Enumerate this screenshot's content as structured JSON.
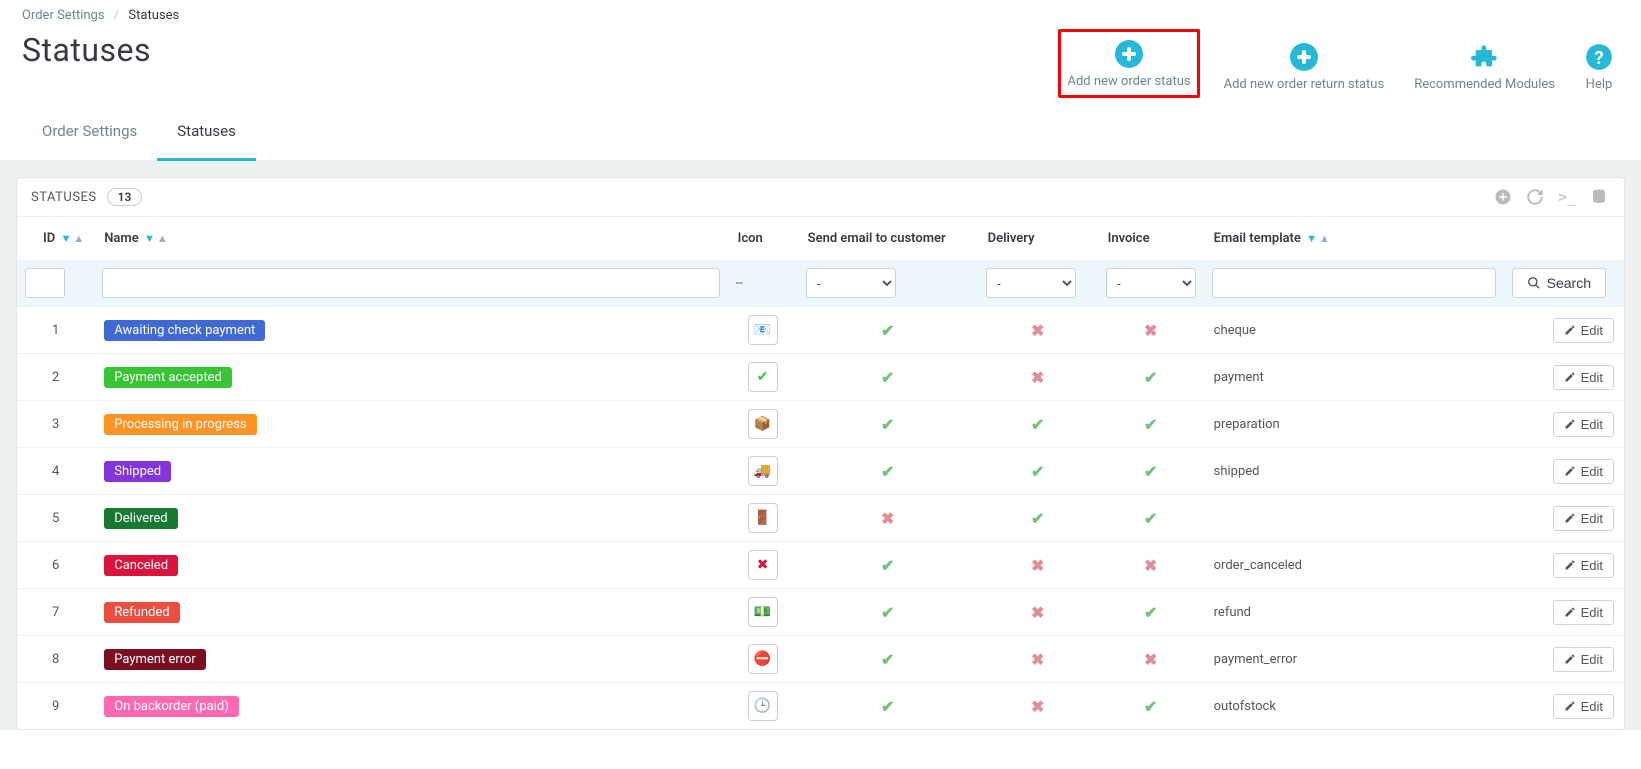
{
  "breadcrumb": {
    "parent": "Order Settings",
    "current": "Statuses"
  },
  "pageTitle": "Statuses",
  "toolbar": {
    "addOrder": "Add new order status",
    "addReturn": "Add new order return status",
    "modules": "Recommended Modules",
    "help": "Help"
  },
  "tabs": {
    "orderSettings": "Order Settings",
    "statuses": "Statuses"
  },
  "panel": {
    "title": "STATUSES",
    "count": "13",
    "searchBtn": "Search",
    "editLabel": "Edit"
  },
  "columns": {
    "id": "ID",
    "name": "Name",
    "icon": "Icon",
    "email": "Send email to customer",
    "delivery": "Delivery",
    "invoice": "Invoice",
    "template": "Email template"
  },
  "filterDash": "--",
  "filterOption": "-",
  "rows": [
    {
      "id": "1",
      "name": "Awaiting check payment",
      "color": "#4069d3",
      "email": true,
      "delivery": false,
      "invoice": false,
      "template": "cheque",
      "icon": "envelope"
    },
    {
      "id": "2",
      "name": "Payment accepted",
      "color": "#37c535",
      "email": true,
      "delivery": false,
      "invoice": true,
      "template": "payment",
      "icon": "tick"
    },
    {
      "id": "3",
      "name": "Processing in progress",
      "color": "#ff9326",
      "email": true,
      "delivery": true,
      "invoice": true,
      "template": "preparation",
      "icon": "box"
    },
    {
      "id": "4",
      "name": "Shipped",
      "color": "#8334db",
      "email": true,
      "delivery": true,
      "invoice": true,
      "template": "shipped",
      "icon": "truck"
    },
    {
      "id": "5",
      "name": "Delivered",
      "color": "#187a32",
      "email": false,
      "delivery": true,
      "invoice": true,
      "template": "",
      "icon": "door"
    },
    {
      "id": "6",
      "name": "Canceled",
      "color": "#dc143c",
      "email": true,
      "delivery": false,
      "invoice": false,
      "template": "order_canceled",
      "icon": "cross"
    },
    {
      "id": "7",
      "name": "Refunded",
      "color": "#ec4e41",
      "email": true,
      "delivery": false,
      "invoice": true,
      "template": "refund",
      "icon": "money"
    },
    {
      "id": "8",
      "name": "Payment error",
      "color": "#7a0f22",
      "email": true,
      "delivery": false,
      "invoice": false,
      "template": "payment_error",
      "icon": "error"
    },
    {
      "id": "9",
      "name": "On backorder (paid)",
      "color": "#ff69b4",
      "email": true,
      "delivery": false,
      "invoice": true,
      "template": "outofstock",
      "icon": "clock"
    }
  ]
}
